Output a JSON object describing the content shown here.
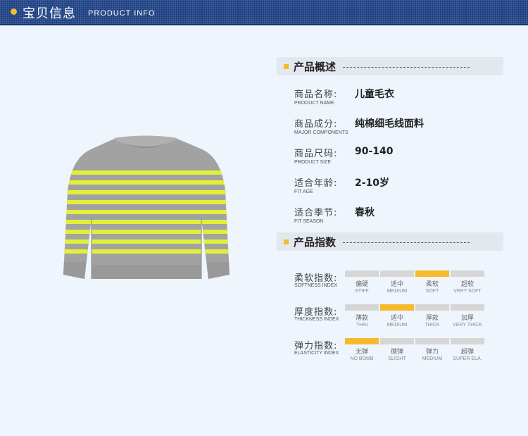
{
  "header": {
    "title_cn": "宝贝信息",
    "title_en": "PRODUCT INFO"
  },
  "overview": {
    "title": "产品概述",
    "rows": [
      {
        "label": "商品名称:",
        "label_en": "PRODUCT NAME",
        "value": "儿童毛衣"
      },
      {
        "label": "商品成分:",
        "label_en": "MAJOR COMPONENTS",
        "value": "纯棉细毛线面料"
      },
      {
        "label": "商品尺码:",
        "label_en": "PRODUCT SIZE",
        "value": "90-140"
      },
      {
        "label": "适合年龄:",
        "label_en": "FIT AGE",
        "value": "2-10岁"
      },
      {
        "label": "适合季节:",
        "label_en": "FIT SEASON",
        "value": "春秋"
      }
    ]
  },
  "indices": {
    "title": "产品指数",
    "rows": [
      {
        "label": "柔软指数:",
        "label_en": "SOFTNESS INDEX",
        "selected": 2,
        "options": [
          {
            "cn": "偏硬",
            "en": "STIFF"
          },
          {
            "cn": "适中",
            "en": "MEDIUM"
          },
          {
            "cn": "柔软",
            "en": "SOFT"
          },
          {
            "cn": "超软",
            "en": "VERY SOFT"
          }
        ]
      },
      {
        "label": "厚度指数:",
        "label_en": "THICKNESS INDEX",
        "selected": 1,
        "options": [
          {
            "cn": "薄款",
            "en": "THIN"
          },
          {
            "cn": "适中",
            "en": "MEDIUM"
          },
          {
            "cn": "厚款",
            "en": "THICK"
          },
          {
            "cn": "加厚",
            "en": "VERY THICK"
          }
        ]
      },
      {
        "label": "弹力指数:",
        "label_en": "ELASTICITY INDEX",
        "selected": 0,
        "options": [
          {
            "cn": "无弹",
            "en": "NO BOMB"
          },
          {
            "cn": "微弹",
            "en": "SLIGHT"
          },
          {
            "cn": "弹力",
            "en": "MEDIUM"
          },
          {
            "cn": "超弹",
            "en": "SUPER ELA."
          }
        ]
      }
    ]
  },
  "colors": {
    "accent": "#f7b92d",
    "header_bg": "#1c3f82",
    "sweater_gray": "#9e9e9e",
    "stripe_lime": "#e4f23a"
  }
}
